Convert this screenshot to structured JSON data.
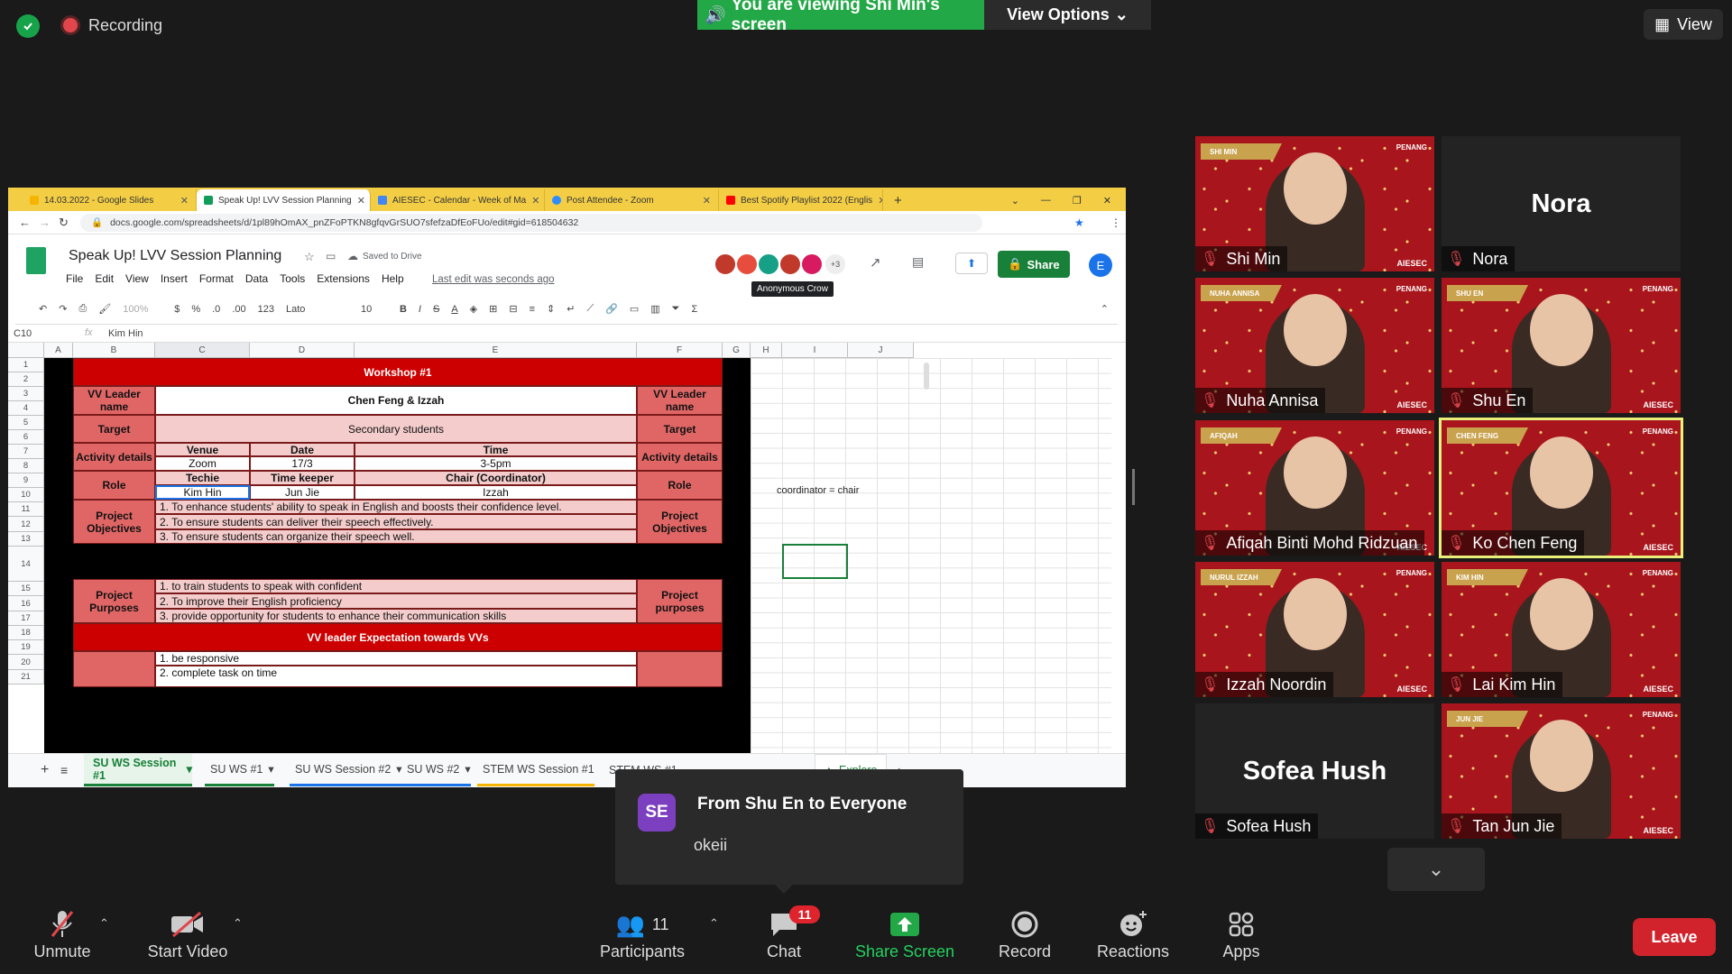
{
  "topbar": {
    "recording_label": "Recording",
    "viewing_text": "You are viewing Shi Min's screen",
    "view_options_label": "View Options",
    "view_label": "View"
  },
  "browser": {
    "tabs": [
      {
        "label": "14.03.2022 - Google Slides",
        "color": "#f4b400"
      },
      {
        "label": "Speak Up! LVV Session Planning",
        "color": "#0f9d58"
      },
      {
        "label": "AIESEC - Calendar - Week of Ma",
        "color": "#4285f4"
      },
      {
        "label": "Post Attendee - Zoom",
        "color": "#2d8cff"
      },
      {
        "label": "Best Spotify Playlist 2022 (Englis",
        "color": "#ff0000"
      }
    ],
    "url": "docs.google.com/spreadsheets/d/1pl89hOmAX_pnZFoPTKN8gfqvGrSUO7sfefzaDfEoFUo/edit#gid=618504632"
  },
  "sheets": {
    "title": "Speak Up! LVV Session Planning",
    "saved_status": "Saved to Drive",
    "menus": [
      "File",
      "Edit",
      "View",
      "Insert",
      "Format",
      "Data",
      "Tools",
      "Extensions",
      "Help"
    ],
    "last_edit": "Last edit was seconds ago",
    "collab_more": "+3",
    "share_label": "Share",
    "user_initial": "E",
    "tooltip": "Anonymous Crow",
    "toolbar": {
      "zoom": "100%",
      "currency": "$",
      "percent": "%",
      "dec_less": ".0",
      "dec_more": ".00",
      "format": "123",
      "font": "Lato",
      "size": "10"
    },
    "cell_ref": "C10",
    "formula_value": "Kim Hin",
    "columns": [
      "A",
      "B",
      "C",
      "D",
      "E",
      "F",
      "G",
      "H",
      "I",
      "J"
    ],
    "rows": [
      "1",
      "2",
      "3",
      "4",
      "5",
      "6",
      "7",
      "8",
      "9",
      "10",
      "11",
      "12",
      "13",
      "14",
      "15",
      "16",
      "17",
      "18",
      "19",
      "20",
      "21"
    ],
    "cells": {
      "workshop": "Workshop #1",
      "vv_leader_name": "VV Leader name",
      "leader_value": "Chen Feng & Izzah",
      "target": "Target",
      "target_value": "Secondary students",
      "activity_details": "Activity details",
      "venue": "Venue",
      "date": "Date",
      "time": "Time",
      "venue_value": "Zoom",
      "date_value": "17/3",
      "time_value": "3-5pm",
      "role": "Role",
      "techie": "Techie",
      "time_keeper": "Time keeper",
      "chair": "Chair (Coordinator)",
      "techie_value": "Kim Hin",
      "time_keeper_value": "Jun Jie",
      "chair_value": "Izzah",
      "note": "coordinator = chair",
      "project_objectives": "Project Objectives",
      "obj1": "1. To enhance students' ability to speak in English and boosts their confidence level.",
      "obj2": "2. To ensure students can deliver their speech effectively.",
      "obj3": "3. To ensure students can organize their speech well.",
      "project_purposes_left": "Project Purposes",
      "project_purposes_right": "Project purposes",
      "pur1": "1. to train students to speak with confident",
      "pur2": "2. To improve their English proficiency",
      "pur3": "3. provide opportunity for students to enhance their communication skills",
      "expectation": "VV leader Expectation towards VVs",
      "exp1": "1. be responsive",
      "exp2": "2. complete task on time"
    },
    "sheet_tabs": [
      "SU WS Session #1",
      "SU WS #1",
      "SU WS Session #2",
      "SU WS #2",
      "STEM WS Session #1",
      "STEM WS #1"
    ],
    "explore_label": "Explore"
  },
  "chat_popup": {
    "initials": "SE",
    "from": "From Shu En to Everyone",
    "message": "okeii"
  },
  "gallery": [
    {
      "name": "Shi Min",
      "banner": "SHI MIN",
      "video": true
    },
    {
      "name": "Nora",
      "video": false
    },
    {
      "name": "Nuha Annisa",
      "banner": "NUHA ANNISA",
      "video": true
    },
    {
      "name": "Shu En",
      "banner": "SHU EN",
      "video": true
    },
    {
      "name": "Afiqah Binti Mohd Ridzuan",
      "banner": "AFIQAH",
      "video": true
    },
    {
      "name": "Ko Chen Feng",
      "banner": "CHEN FENG",
      "video": true,
      "active": true
    },
    {
      "name": "Izzah Noordin",
      "banner": "NURUL IZZAH",
      "video": true
    },
    {
      "name": "Lai Kim Hin",
      "banner": "KIM HIN",
      "video": true
    },
    {
      "name": "Sofea Hush",
      "video": false
    },
    {
      "name": "Tan Jun Jie",
      "banner": "JUN JIE",
      "video": true
    }
  ],
  "tile_logo": "PENANG",
  "tile_footer": "AIESEC",
  "controls": {
    "unmute": "Unmute",
    "start_video": "Start Video",
    "participants": "Participants",
    "participants_count": "11",
    "chat": "Chat",
    "chat_badge": "11",
    "share_screen": "Share Screen",
    "record": "Record",
    "reactions": "Reactions",
    "apps": "Apps",
    "leave": "Leave"
  },
  "colors": {
    "zoom_green": "#23a847",
    "sheet_red": "#cc0000",
    "sheet_mid": "#e06666",
    "sheet_pink": "#f4cccc",
    "leave_red": "#d0232b",
    "active_border": "#e9f07a"
  }
}
